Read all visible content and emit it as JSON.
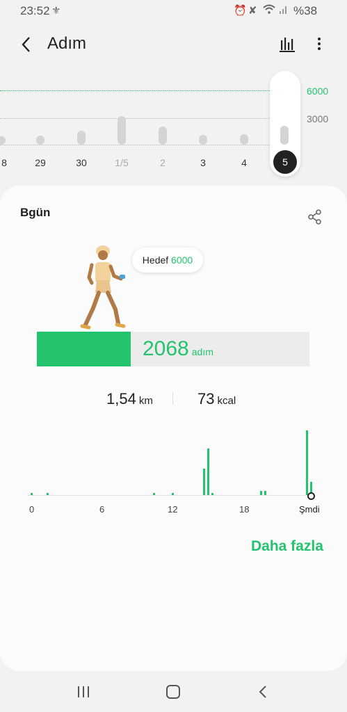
{
  "status_bar": {
    "time": "23:52",
    "battery": "%38",
    "icons": [
      "notification-icon",
      "alarm-icon",
      "mute-icon",
      "wifi-icon",
      "signal-icon"
    ]
  },
  "app_bar": {
    "title": "Adım",
    "icons": [
      "back-icon",
      "bar-chart-icon",
      "more-icon"
    ]
  },
  "week_chart": {
    "y_ticks": [
      "6000",
      "3000"
    ],
    "goal": 6000,
    "days": [
      "8",
      "29",
      "30",
      "1/5",
      "2",
      "3",
      "4",
      "5"
    ],
    "muted_days": [
      "1/5",
      "2"
    ],
    "selected_day": "5"
  },
  "today": {
    "label": "Bgün",
    "goal_label": "Hedef",
    "goal_value": "6000",
    "steps": "2068",
    "steps_unit": "adım",
    "progress_fraction": 0.345,
    "distance": "1,54",
    "distance_unit": "km",
    "calories": "73",
    "calories_unit": "kcal"
  },
  "hourly_chart": {
    "x_ticks": [
      "0",
      "6",
      "12",
      "18",
      "Şmdi"
    ]
  },
  "more_link": "Daha fazla",
  "colors": {
    "accent": "#24c36e",
    "selected": "#222222"
  }
}
